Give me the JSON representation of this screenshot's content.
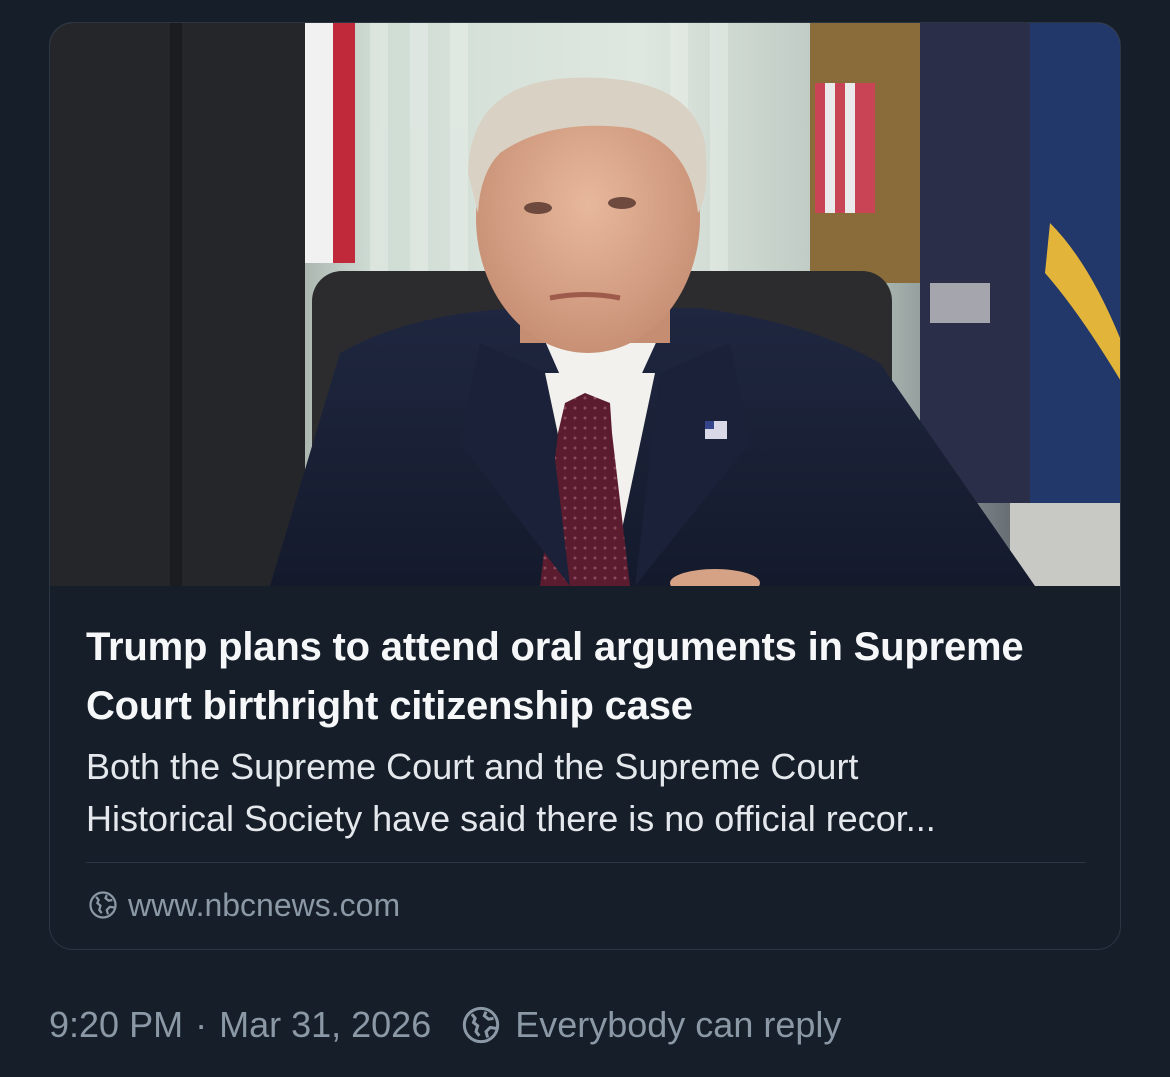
{
  "link_card": {
    "title": "Trump plans to attend oral arguments in Supreme Court birthright citizenship case",
    "description": "Both the Supreme Court and the Supreme Court\nHistorical Society have said there is no official recor...",
    "source": "www.nbcnews.com",
    "source_icon": "globe-icon"
  },
  "post_meta": {
    "time": "9:20 PM",
    "separator": "·",
    "date": "Mar 31, 2026",
    "reply_setting": "Everybody can reply",
    "reply_icon": "globe-icon"
  },
  "colors": {
    "background": "#161e29",
    "border": "#2c3643",
    "primary_text": "#f5f7f9",
    "secondary_text": "#8b98a5"
  }
}
